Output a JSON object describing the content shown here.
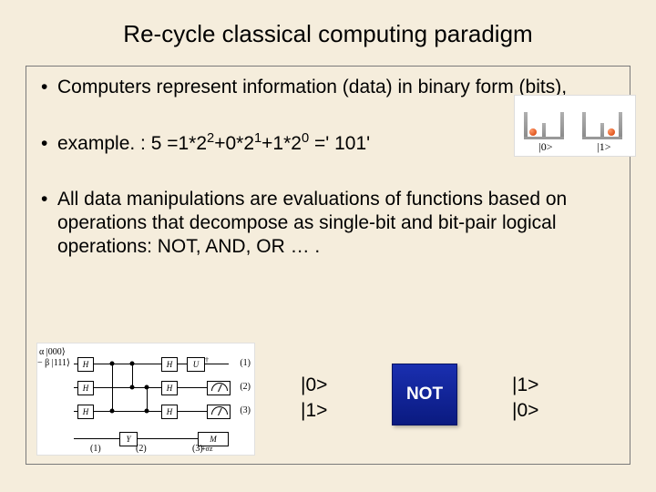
{
  "title": "Re-cycle classical computing paradigm",
  "bullets": {
    "b1_a": "Computers represent information (data) in binary form (",
    "b1_b": "bits",
    "b1_c": "),",
    "b2_pre": "example. :   5 =",
    "b2_t1": "1*2",
    "b2_e1": "2",
    "b2_t2": "+0*2",
    "b2_e2": "1",
    "b2_t3": "+1*2",
    "b2_e3": "0",
    "b2_tail": " =' 101'",
    "b3": "All data manipulations are evaluations of functions based on operations that decompose as single-bit and bit-pair logical operations: NOT, AND, OR … ."
  },
  "bits_figure": {
    "left_label": "|0>",
    "right_label": "|1>"
  },
  "circuit": {
    "state_a": "α |000⟩",
    "state_b": "− β |111⟩",
    "h_label": "H",
    "u_label": "U",
    "y_label": "Y",
    "m_label": "M",
    "out_sub": "+σz",
    "row0": "(1)",
    "row1": "(2)",
    "row2": "(3)",
    "bottom0": "(1)",
    "bottom1": "(2)",
    "bottom2": "(3)"
  },
  "not_gate": {
    "in_top": "|0>",
    "in_bot": "|1>",
    "label": "NOT",
    "out_top": "|1>",
    "out_bot": "|0>"
  }
}
